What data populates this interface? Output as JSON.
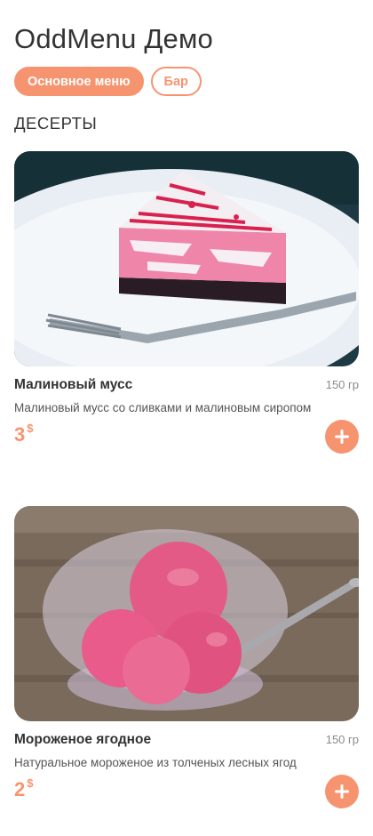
{
  "header": {
    "title": "OddMenu Демо"
  },
  "tabs": [
    {
      "label": "Основное меню",
      "active": true
    },
    {
      "label": "Бар",
      "active": false
    }
  ],
  "section": {
    "title": "ДЕСЕРТЫ"
  },
  "items": [
    {
      "name": "Малиновый мусс",
      "weight": "150 гр",
      "description": "Малиновый мусс со сливками и малиновым сиропом",
      "price": "3",
      "currency": "$",
      "image": "raspberry-mousse-cake-photo"
    },
    {
      "name": "Мороженое ягодное",
      "weight": "150 гр",
      "description": "Натуральное мороженое из толченых лесных ягод",
      "price": "2",
      "currency": "$",
      "image": "berry-ice-cream-bowl-photo"
    }
  ],
  "colors": {
    "accent": "#f79470",
    "text": "#333333",
    "muted": "#8a8a8a"
  },
  "icons": {
    "add": "plus-icon"
  }
}
